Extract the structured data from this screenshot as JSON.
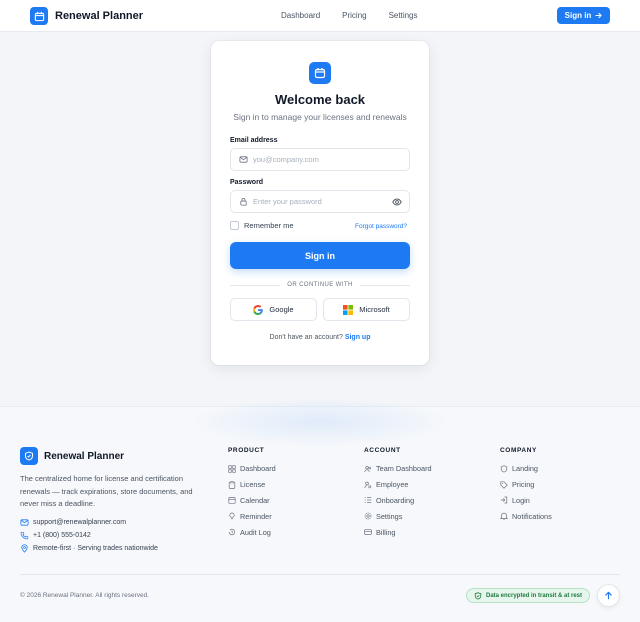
{
  "header": {
    "brand": "Renewal Planner",
    "nav": [
      "Dashboard",
      "Pricing",
      "Settings"
    ],
    "signin_label": "Sign in"
  },
  "card": {
    "title": "Welcome back",
    "subtitle": "Sign in to manage your licenses and renewals",
    "email_label": "Email address",
    "email_placeholder": "you@company.com",
    "email_value": "",
    "password_label": "Password",
    "password_placeholder": "Enter your password",
    "password_value": "",
    "remember_label": "Remember me",
    "remember_checked": false,
    "forgot_label": "Forgot password?",
    "submit_label": "Sign in",
    "divider_label": "OR CONTINUE WITH",
    "google_label": "Google",
    "microsoft_label": "Microsoft",
    "signup_prompt": "Don't have an account?",
    "signup_link": "Sign up"
  },
  "footer": {
    "brand": "Renewal Planner",
    "description": "The centralized home for license and certification renewals — track expirations, store documents, and never miss a deadline.",
    "contact": {
      "email": "support@renewalplanner.com",
      "phone": "+1 (800) 555-0142",
      "location": "Remote-first · Serving trades nationwide"
    },
    "columns": [
      {
        "title": "PRODUCT",
        "items": [
          {
            "label": "Dashboard",
            "icon": "grid-icon"
          },
          {
            "label": "License",
            "icon": "clipboard-icon"
          },
          {
            "label": "Calendar",
            "icon": "calendar-icon"
          },
          {
            "label": "Reminder",
            "icon": "bulb-icon"
          },
          {
            "label": "Audit Log",
            "icon": "history-icon"
          }
        ]
      },
      {
        "title": "ACCOUNT",
        "items": [
          {
            "label": "Team Dashboard",
            "icon": "users-icon"
          },
          {
            "label": "Employee",
            "icon": "user-cog-icon"
          },
          {
            "label": "Onboarding",
            "icon": "list-icon"
          },
          {
            "label": "Settings",
            "icon": "gear-icon"
          },
          {
            "label": "Billing",
            "icon": "card-icon"
          }
        ]
      },
      {
        "title": "COMPANY",
        "items": [
          {
            "label": "Landing",
            "icon": "shield-icon"
          },
          {
            "label": "Pricing",
            "icon": "tag-icon"
          },
          {
            "label": "Login",
            "icon": "login-icon"
          },
          {
            "label": "Notifications",
            "icon": "bell-icon"
          }
        ]
      }
    ],
    "copyright": "© 2026 Renewal Planner. All rights reserved.",
    "badge": "Data encrypted in transit & at rest"
  },
  "colors": {
    "accent": "#1d7af3",
    "badge_bg": "#e6f6ec",
    "badge_text": "#1f7a3e"
  }
}
